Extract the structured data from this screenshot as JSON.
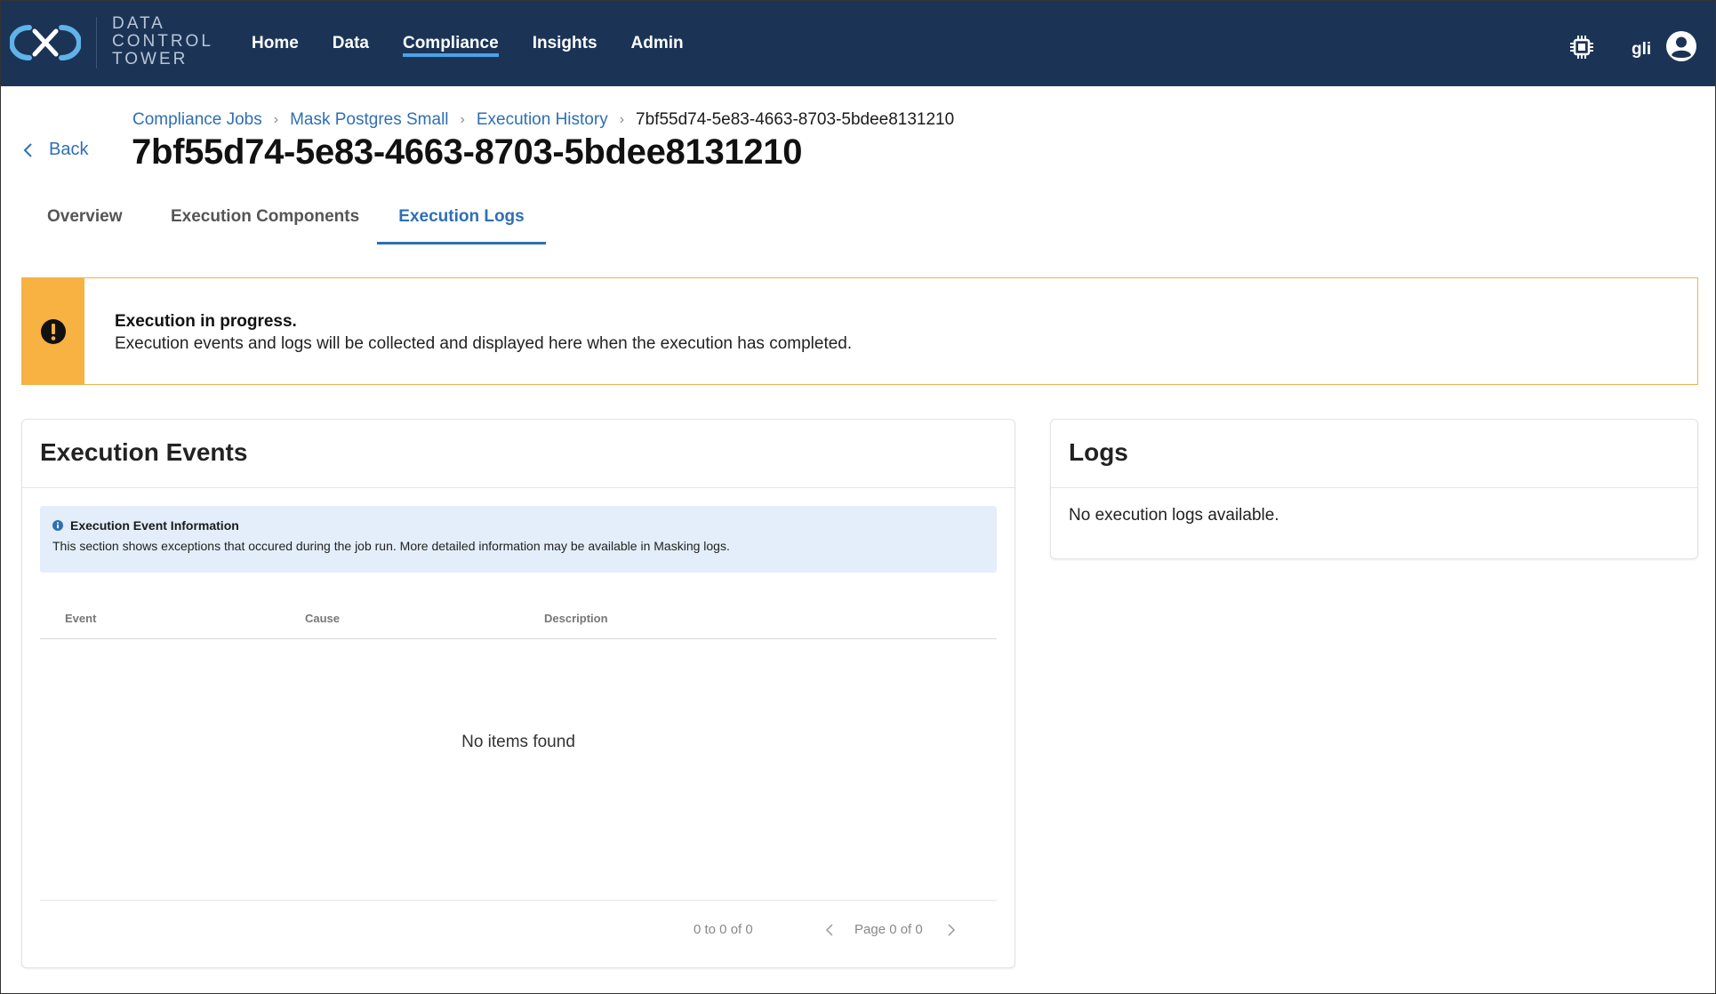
{
  "brand": {
    "line1": "DATA",
    "line2": "CONTROL",
    "line3": "TOWER"
  },
  "nav": [
    {
      "label": "Home",
      "active": false
    },
    {
      "label": "Data",
      "active": false
    },
    {
      "label": "Compliance",
      "active": true
    },
    {
      "label": "Insights",
      "active": false
    },
    {
      "label": "Admin",
      "active": false
    }
  ],
  "user": {
    "name": "gli",
    "icons": [
      "chip-icon",
      "user-account-icon"
    ]
  },
  "back_label": "Back",
  "breadcrumb": {
    "items": [
      "Compliance Jobs",
      "Mask Postgres Small",
      "Execution History"
    ],
    "current": "7bf55d74-5e83-4663-8703-5bdee8131210",
    "separator": "›"
  },
  "page_title": "7bf55d74-5e83-4663-8703-5bdee8131210",
  "tabs": [
    {
      "label": "Overview",
      "active": false
    },
    {
      "label": "Execution Components",
      "active": false
    },
    {
      "label": "Execution Logs",
      "active": true
    }
  ],
  "banner": {
    "title": "Execution in progress.",
    "text": "Execution events and logs will be collected and displayed here when the execution has completed.",
    "color": "#f7b241"
  },
  "events": {
    "title": "Execution Events",
    "info_title": "Execution Event Information",
    "info_text": "This section shows exceptions that occured during the job run. More detailed information may be available in Masking logs.",
    "columns": [
      "Event",
      "Cause",
      "Description"
    ],
    "empty": "No items found",
    "pager_count": "0 to 0 of 0",
    "pager_page": "Page 0 of 0"
  },
  "logs": {
    "title": "Logs",
    "empty": "No execution logs available."
  },
  "colors": {
    "nav_bg": "#1b3456",
    "accent": "#2f6fb3",
    "warning": "#f7b241",
    "info_bg": "#e3eefa"
  }
}
